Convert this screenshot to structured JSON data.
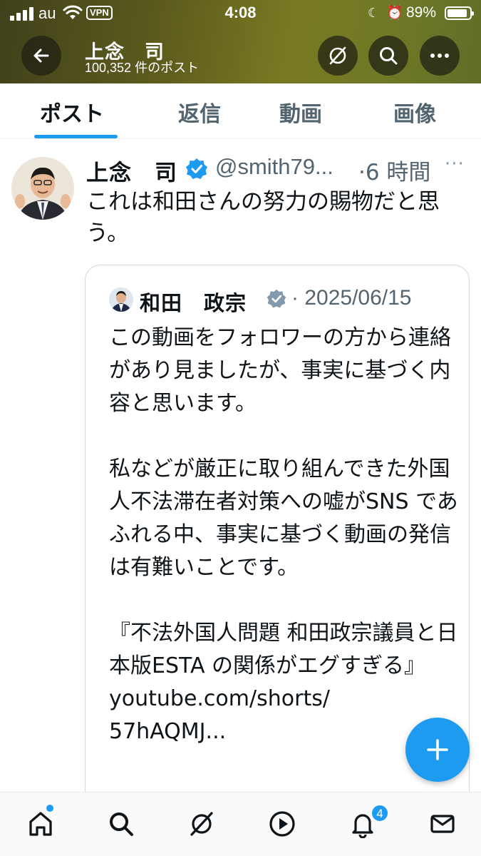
{
  "status_bar": {
    "carrier": "au",
    "vpn": "VPN",
    "time": "4:08",
    "battery_percent_text": "89%",
    "battery_level": 0.89
  },
  "header": {
    "display_name": "上念　司",
    "post_count": "100,352 件のポスト"
  },
  "tabs": [
    "ポスト",
    "返信",
    "動画",
    "画像"
  ],
  "active_tab": 0,
  "post": {
    "name": "上念　司",
    "handle": "@smith79...",
    "separator": "·",
    "time": "6 時間",
    "more": "···",
    "text": "これは和田さんの努力の賜物だと思う。"
  },
  "quoted_post": {
    "name": "和田　政宗",
    "date": "· 2025/06/15",
    "text": "この動画をフォロワーの方から連絡があり見ましたが、事実に基づく内容と思います。\n\n私などが厳正に取り組んできた外国人不法滞在者対策への嘘がSNS であふれる中、事実に基づく動画の発信は有難いことです。\n\n『不法外国人問題 和田政宗議員と日本版ESTA の関係がエグすぎる』youtube.com/shorts/\n57hAQMJ..."
  },
  "bottom_nav": {
    "notifications_badge": "4"
  },
  "colors": {
    "accent": "#1d9bf0",
    "text": "#0f1419",
    "secondary": "#536471"
  },
  "icons": [
    "back-arrow-icon",
    "grok-icon",
    "search-icon",
    "more-icon",
    "verified-badge-icon",
    "plus-icon",
    "home-icon",
    "play-icon",
    "bell-icon",
    "mail-icon"
  ]
}
